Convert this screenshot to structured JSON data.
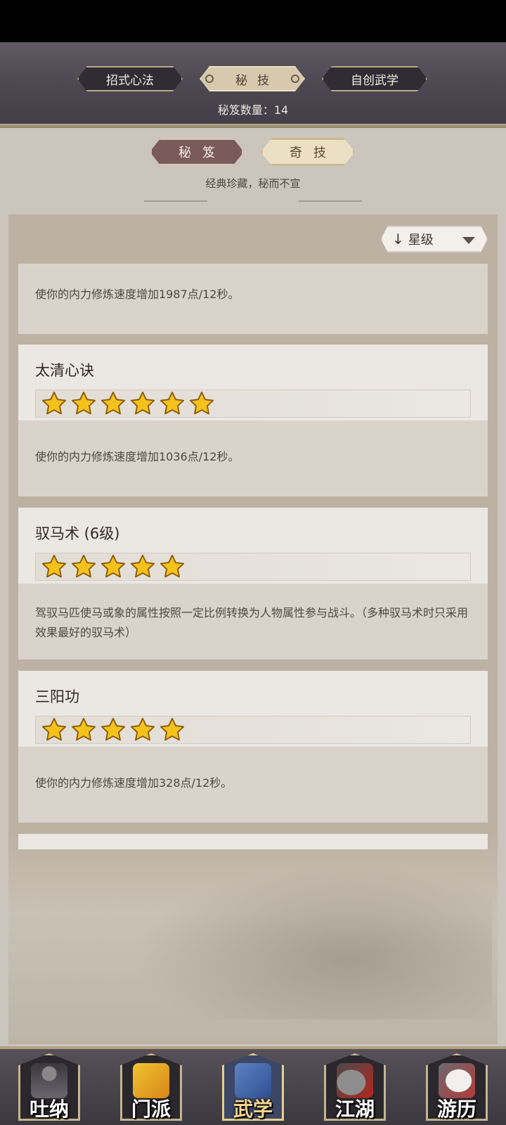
{
  "top_tabs": [
    {
      "label": "招式心法",
      "active": false
    },
    {
      "label": "秘技",
      "active": true
    },
    {
      "label": "自创武学",
      "active": false
    }
  ],
  "secret_count_text": "秘笈数量：14",
  "sub_tabs": [
    {
      "label": "秘笈",
      "active": true
    },
    {
      "label": "奇技",
      "active": false
    }
  ],
  "motto": "经典珍藏，秘而不宣",
  "sort": {
    "label": "星级",
    "arrow_icon": "arrow-down-icon",
    "caret_icon": "caret-down-icon"
  },
  "cards": [
    {
      "title": "",
      "stars": 0,
      "desc": "使你的内力修炼速度增加1987点/12秒。"
    },
    {
      "title": "太清心诀",
      "stars": 6,
      "desc": "使你的内力修炼速度增加1036点/12秒。"
    },
    {
      "title": "驭马术 (6级)",
      "stars": 5,
      "desc": "驾驭马匹使马或象的属性按照一定比例转换为人物属性参与战斗。（多种驭马术时只采用效果最好的驭马术）"
    },
    {
      "title": "三阳功",
      "stars": 5,
      "desc": "使你的内力修炼速度增加328点/12秒。"
    }
  ],
  "bottom_nav": [
    {
      "label": "吐纳",
      "icon": "meditating-figure-icon",
      "active": false
    },
    {
      "label": "门派",
      "icon": "sect-flag-icon",
      "active": false
    },
    {
      "label": "武学",
      "icon": "martial-book-icon",
      "active": true
    },
    {
      "label": "江湖",
      "icon": "hat-icon",
      "active": false
    },
    {
      "label": "游历",
      "icon": "horse-icon",
      "active": false
    }
  ],
  "colors": {
    "star_fill": "#f4c21b",
    "star_stroke": "#8a5a08",
    "accent_active_tab": "#7b5a5c"
  }
}
